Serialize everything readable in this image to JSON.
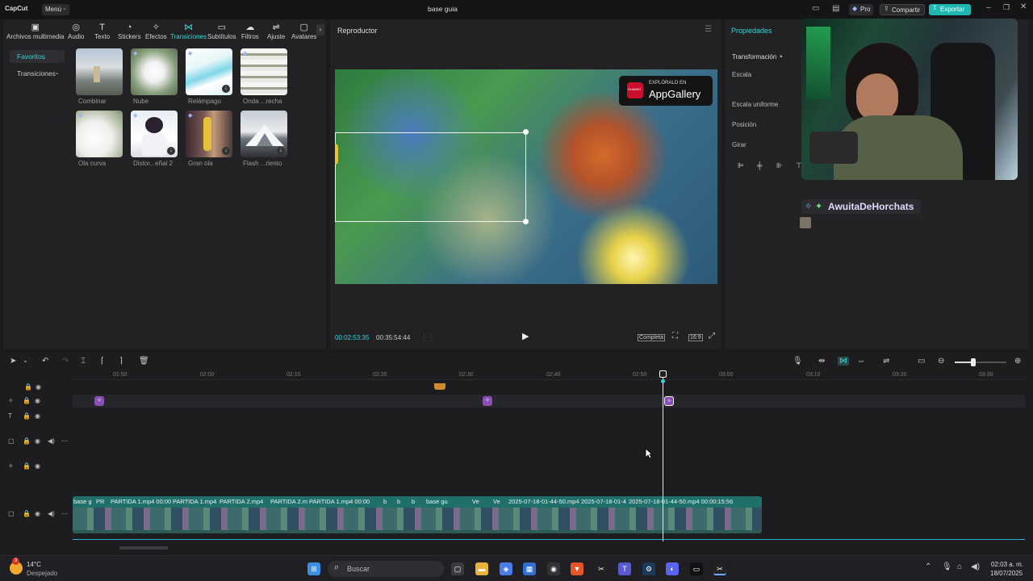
{
  "titlebar": {
    "app_name": "CapCut",
    "menu_label": "Menú",
    "project_title": "base guia",
    "pro_label": "Pro",
    "share_label": "Compartir",
    "export_label": "Exportar"
  },
  "toolbar": {
    "items": [
      {
        "label": "Archivos multimedia",
        "icon": "media-icon"
      },
      {
        "label": "Audio",
        "icon": "audio-icon"
      },
      {
        "label": "Texto",
        "icon": "text-icon"
      },
      {
        "label": "Stickers",
        "icon": "sticker-icon"
      },
      {
        "label": "Efectos",
        "icon": "effects-icon"
      },
      {
        "label": "Transiciones",
        "icon": "transition-icon"
      },
      {
        "label": "Subtítulos",
        "icon": "subtitles-icon"
      },
      {
        "label": "Filtros",
        "icon": "filter-icon"
      },
      {
        "label": "Ajuste",
        "icon": "adjust-icon"
      },
      {
        "label": "Avatares",
        "icon": "avatar-icon"
      }
    ],
    "active_index": 5
  },
  "sidebar": {
    "items": [
      {
        "label": "Favoritos"
      },
      {
        "label": "Transiciones"
      }
    ]
  },
  "transitions": [
    {
      "label": "Combinar"
    },
    {
      "label": "Nube"
    },
    {
      "label": "Relámpago"
    },
    {
      "label": "Onda ...recha"
    },
    {
      "label": "Ola curva"
    },
    {
      "label": "Distor...eñal 2"
    },
    {
      "label": "Gran ola"
    },
    {
      "label": "Flash ...riento"
    }
  ],
  "player": {
    "title": "Reproductor",
    "current_time": "00:02:53:35",
    "total_time": "00:35:54:44",
    "complete_label": "Completa",
    "ratio_label": "16:9",
    "ad_top": "EXPLÓRALO EN",
    "ad_main": "AppGallery",
    "ad_brand": "HUAWEI"
  },
  "properties": {
    "title": "Propiedades",
    "transform_label": "Transformación",
    "scale_label": "Escala",
    "uniform_scale_label": "Escala uniforme",
    "position_label": "Posición",
    "rotate_label": "Girar"
  },
  "stream": {
    "username": "AwuitaDeHorchats"
  },
  "timeline": {
    "ruler": [
      "01:50",
      "02:00",
      "02:10",
      "02:20",
      "02:30",
      "02:40",
      "02:50",
      "03:00",
      "03:10",
      "03:20",
      "03:30"
    ],
    "clips": [
      {
        "label": "base g"
      },
      {
        "label": "PR"
      },
      {
        "label": "PARTIDA 1.mp4  00:00"
      },
      {
        "label": "PARTIDA 1.mp4"
      },
      {
        "label": "PARTIDA 2.mp4"
      },
      {
        "label": "PARTIDA 2.m"
      },
      {
        "label": "PARTIDA 1.mp4  00:00"
      },
      {
        "label": "b"
      },
      {
        "label": "b"
      },
      {
        "label": "b"
      },
      {
        "label": "base gu"
      },
      {
        "label": "Ve"
      },
      {
        "label": "Ve"
      },
      {
        "label": "2025-07-18-01-44-50.mp4"
      },
      {
        "label": "2025-07-18-01-4"
      },
      {
        "label": "2025-07-18-01-44-50.mp4  00:00:15:56"
      }
    ]
  },
  "taskbar": {
    "weather_temp": "14°C",
    "weather_desc": "Despejado",
    "weather_badge": "3",
    "search_placeholder": "Buscar",
    "time": "02:03 a. m.",
    "date": "18/07/2025"
  },
  "colors": {
    "accent": "#2fd7d7",
    "export_bg": "#1fb7b0",
    "clip_bg": "#1f6f6a",
    "marker": "#8c4fb8"
  }
}
